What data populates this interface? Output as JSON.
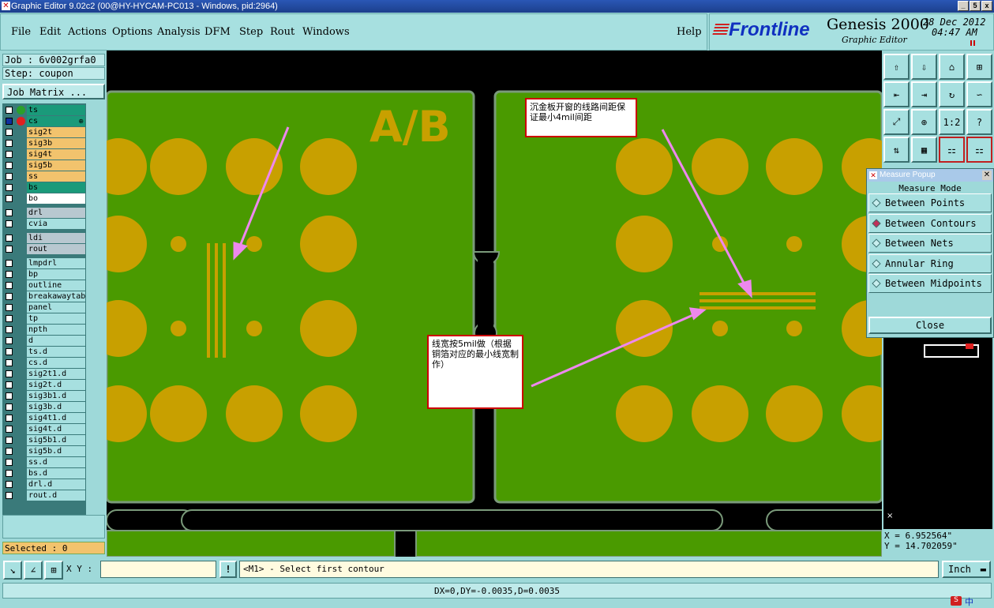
{
  "window": {
    "title": "Graphic Editor 9.02c2 (00@HY-HYCAM-PC013 - Windows, pid:2964)",
    "minimize": "_",
    "restore": "5",
    "close": "x"
  },
  "menu": {
    "items": [
      "File",
      "Edit",
      "Actions",
      "Options",
      "Analysis",
      "DFM",
      "Step",
      "Rout",
      "Windows"
    ],
    "help": "Help"
  },
  "brand": {
    "logo": "Frontline",
    "product": "Genesis 2000",
    "subtitle": "Graphic Editor",
    "date": "28 Dec 2012",
    "time": "04:47 AM"
  },
  "job": {
    "job_label": "Job : 6v002grfa0",
    "step_label": "Step: coupon",
    "matrix_button": "Job Matrix ..."
  },
  "layers": [
    {
      "name": "ts",
      "color": "#1a9a7a",
      "dot": "#2aa02a"
    },
    {
      "name": "cs",
      "color": "#1a9a7a",
      "dot": "#e02020",
      "marker": "⊕"
    },
    {
      "name": "sig2t",
      "color": "#f2c36d"
    },
    {
      "name": "sig3b",
      "color": "#f2c36d"
    },
    {
      "name": "sig4t",
      "color": "#f2c36d"
    },
    {
      "name": "sig5b",
      "color": "#f2c36d"
    },
    {
      "name": "ss",
      "color": "#f2c36d"
    },
    {
      "name": "bs",
      "color": "#1a9a7a"
    },
    {
      "name": "bo",
      "color": "#ffffff"
    },
    {
      "name": "drl",
      "color": "#b8c8d0"
    },
    {
      "name": "cvia",
      "color": "#a7e0e0"
    },
    {
      "name": "ldi",
      "color": "#b8c8d0"
    },
    {
      "name": "rout",
      "color": "#b8c8d0"
    },
    {
      "name": "lmpdrl",
      "color": "#a7e0e0"
    },
    {
      "name": "bp",
      "color": "#a7e0e0"
    },
    {
      "name": "outline",
      "color": "#a7e0e0"
    },
    {
      "name": "breakawaytab",
      "color": "#a7e0e0"
    },
    {
      "name": "panel",
      "color": "#a7e0e0"
    },
    {
      "name": "tp",
      "color": "#a7e0e0"
    },
    {
      "name": "npth",
      "color": "#a7e0e0"
    },
    {
      "name": "d",
      "color": "#a7e0e0"
    },
    {
      "name": "ts.d",
      "color": "#a7e0e0"
    },
    {
      "name": "cs.d",
      "color": "#a7e0e0"
    },
    {
      "name": "sig2t1.d",
      "color": "#a7e0e0"
    },
    {
      "name": "sig2t.d",
      "color": "#a7e0e0"
    },
    {
      "name": "sig3b1.d",
      "color": "#a7e0e0"
    },
    {
      "name": "sig3b.d",
      "color": "#a7e0e0"
    },
    {
      "name": "sig4t1.d",
      "color": "#a7e0e0"
    },
    {
      "name": "sig4t.d",
      "color": "#a7e0e0"
    },
    {
      "name": "sig5b1.d",
      "color": "#a7e0e0"
    },
    {
      "name": "sig5b.d",
      "color": "#a7e0e0"
    },
    {
      "name": "ss.d",
      "color": "#a7e0e0"
    },
    {
      "name": "bs.d",
      "color": "#a7e0e0"
    },
    {
      "name": "drl.d",
      "color": "#a7e0e0"
    },
    {
      "name": "rout.d",
      "color": "#a7e0e0"
    }
  ],
  "selected": "Selected : 0",
  "canvas": {
    "label": "A/B",
    "note1": "沉金板开窗的线路间距保证最小4mil间距",
    "note2": "线宽按5mil做（根据铜箔对应的最小线宽制作）"
  },
  "toolbox": {
    "buttons": [
      "up-icon",
      "down-icon",
      "home-icon",
      "grid-icon",
      "left-icon",
      "right-icon",
      "rotate-icon",
      "snake-icon",
      "fit-icon",
      "zoom-icon",
      "1:2",
      "?",
      "flip-icon",
      "grid2-icon",
      "layer-a-icon",
      "layer-b-icon"
    ],
    "ratio": "1:2",
    "help": "?"
  },
  "measure": {
    "title": "Measure Popup",
    "mode": "Measure Mode",
    "options": [
      "Between Points",
      "Between Contours",
      "Between Nets",
      "Annular Ring",
      "Between Midpoints"
    ],
    "selected": 1,
    "close": "Close"
  },
  "coords": {
    "x": "X = 6.952564\"",
    "y": "Y = 14.702059\""
  },
  "bottom": {
    "xy_label": "X Y :",
    "xy_value": "",
    "prompt": "<M1> - Select first contour",
    "units": "Inch",
    "status": "DX=0,DY=-0.0035,D=0.0035",
    "ime": "中"
  },
  "colors": {
    "copper": "#c8a000",
    "board": "#4a9a00",
    "board_edge": "#7a9a7a"
  }
}
